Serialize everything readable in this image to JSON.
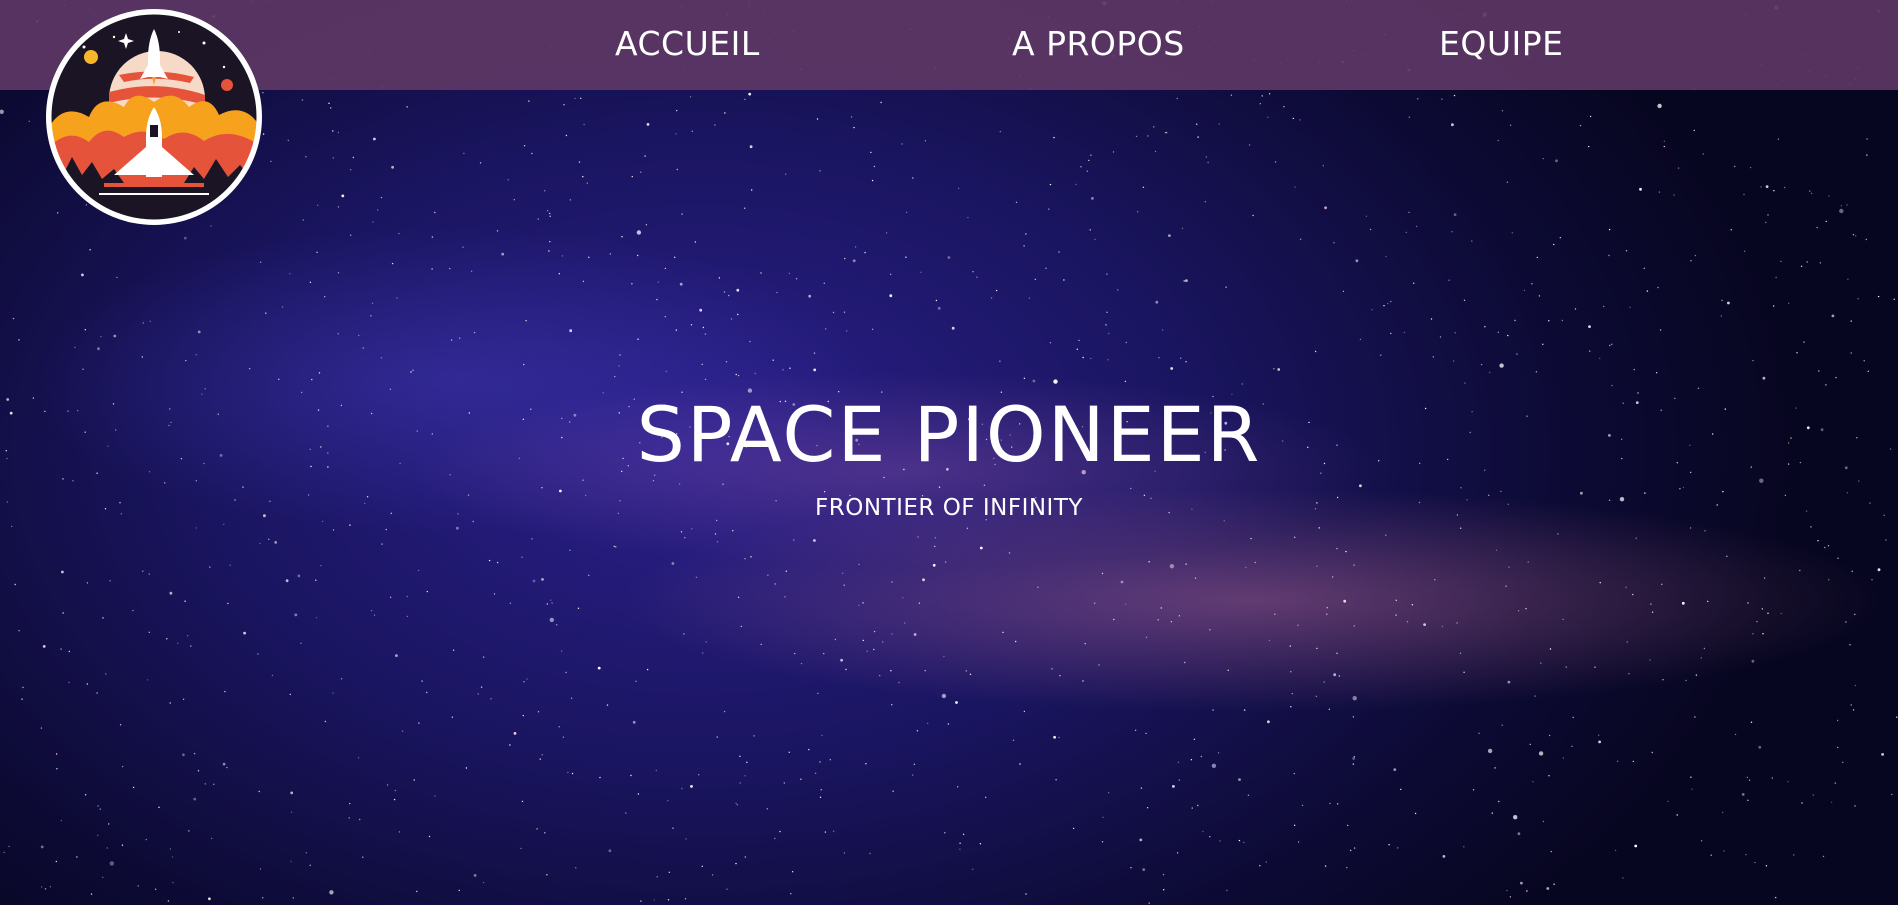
{
  "nav": {
    "items": [
      {
        "label": "ACCUEIL"
      },
      {
        "label": "A PROPOS"
      },
      {
        "label": "EQUIPE"
      }
    ]
  },
  "logo": {
    "icon": "rocket-launch-badge-icon"
  },
  "hero": {
    "title": "SPACE PIONEER",
    "subtitle": "FRONTIER OF INFINITY"
  },
  "colors": {
    "navbar": "#5c3764",
    "sky_dark": "#0c0a33",
    "sky_mid": "#2a1f8a",
    "milky_way": "#be6e96",
    "text": "#ffffff",
    "logo_orange": "#f6a21c",
    "logo_red": "#e5533b",
    "logo_dark": "#1b1424"
  }
}
